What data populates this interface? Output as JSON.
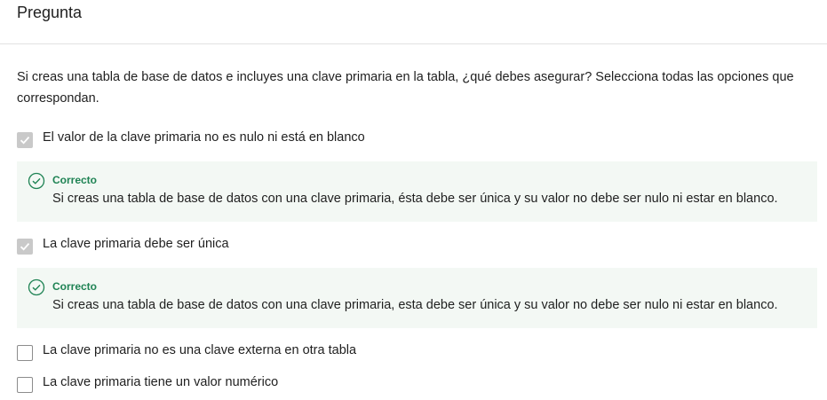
{
  "header": {
    "title": "Pregunta"
  },
  "question": {
    "prompt": "Si creas una tabla de base de datos e incluyes una clave primaria en la tabla, ¿qué debes asegurar? Selecciona todas las opciones que correspondan."
  },
  "options": [
    {
      "label": "El valor de la clave primaria no es nulo ni está en blanco",
      "checked": true,
      "feedback": {
        "status": "Correcto",
        "text": "Si creas una tabla de base de datos con una clave primaria, ésta debe ser única y su valor no debe ser nulo ni estar en blanco."
      }
    },
    {
      "label": "La clave primaria debe ser única",
      "checked": true,
      "feedback": {
        "status": "Correcto",
        "text": "Si creas una tabla de base de datos con una clave primaria, esta debe ser única y su valor no debe ser nulo ni estar en blanco."
      }
    },
    {
      "label": "La clave primaria no es una clave externa en otra tabla",
      "checked": false
    },
    {
      "label": "La clave primaria tiene un valor numérico",
      "checked": false
    }
  ],
  "colors": {
    "correct": "#1f8354",
    "feedback_bg": "#f3f8f4",
    "checkbox_checked": "#c9c9c9"
  }
}
